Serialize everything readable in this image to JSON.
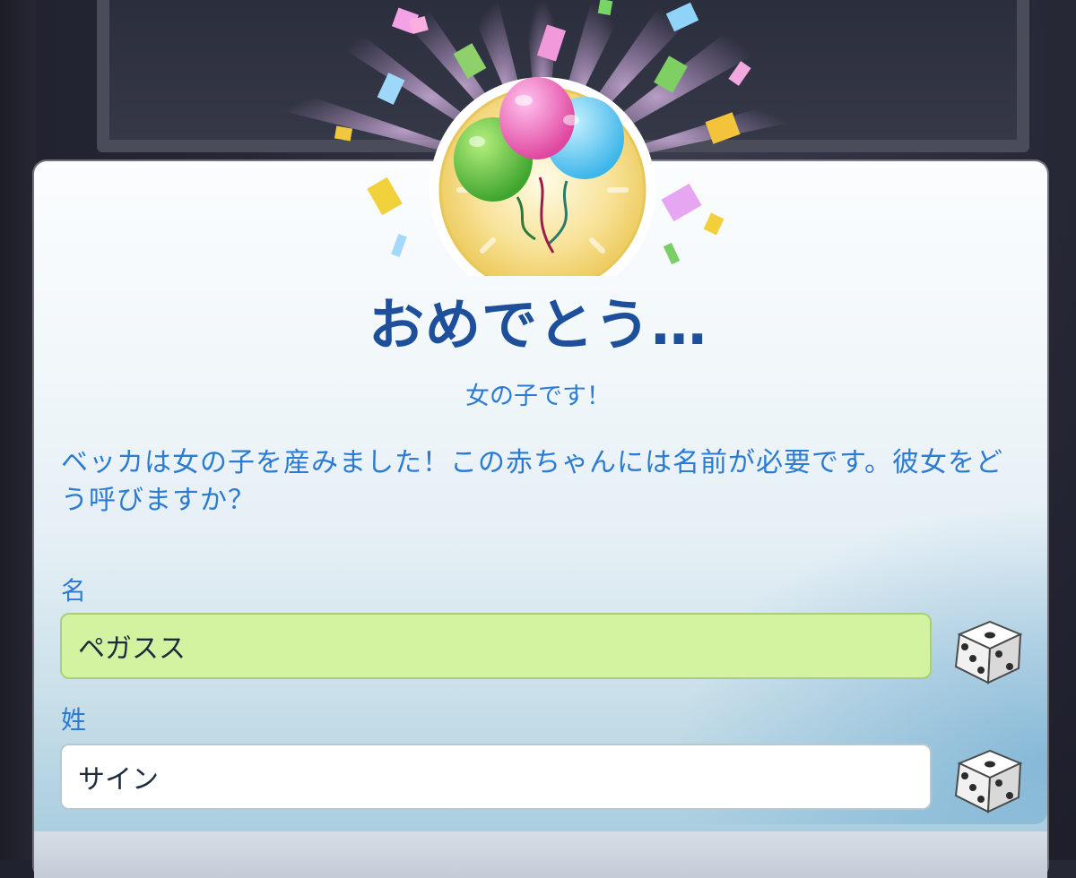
{
  "dialog": {
    "title": "おめでとう…",
    "subtitle": "女の子です！",
    "message": "ベッカは女の子を産みました！この赤ちゃんには名前が必要です。彼女をどう呼びますか？",
    "icon": "balloons-icon"
  },
  "first_name": {
    "label": "名",
    "value": "ペガスス",
    "randomize_icon": "dice-icon"
  },
  "last_name": {
    "label": "姓",
    "value": "サイン",
    "randomize_icon": "dice-icon"
  },
  "colors": {
    "title": "#1e4f9a",
    "text": "#2b7bd3",
    "active_field": "#d3f3a1",
    "medallion": "#f3d873"
  }
}
